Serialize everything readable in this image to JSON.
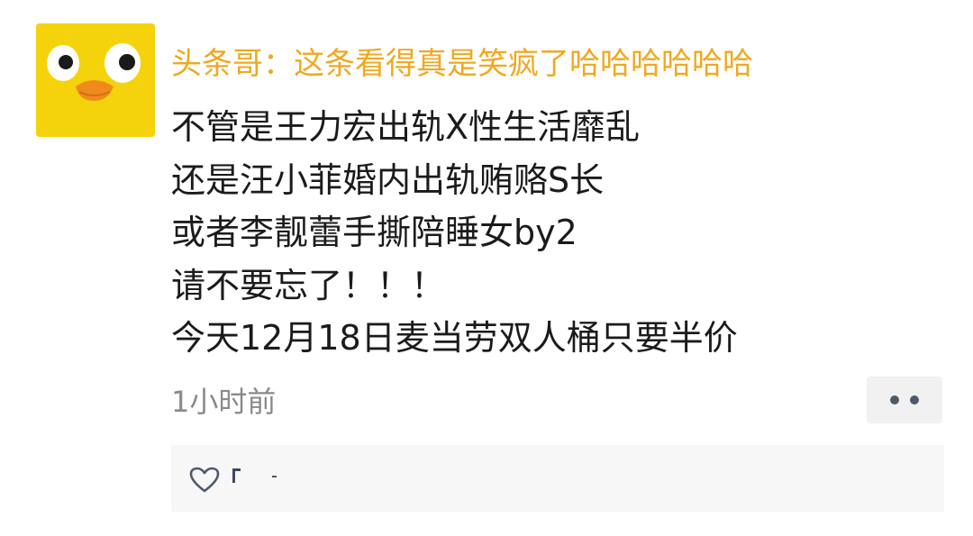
{
  "comment": {
    "username_line": "头条哥：这条看得真是笑疯了哈哈哈哈哈哈",
    "body_lines": [
      "不管是王力宏出轨X性生活靡乱",
      "还是汪小菲婚内出轨贿赂S长",
      "或者李靓蕾手撕陪睡女by2",
      "请不要忘了！！！",
      "今天12月18日麦当劳双人桶只要半价"
    ],
    "timestamp": "1小时前"
  },
  "icons": {
    "avatar": "yellow-duck-avatar",
    "more": "more-dots-icon",
    "like": "heart-outline-icon"
  },
  "colors": {
    "username": "#f1a820",
    "body_text": "#1b1b1b",
    "timestamp": "#8a8a8a",
    "icon": "#4d5a6b"
  }
}
